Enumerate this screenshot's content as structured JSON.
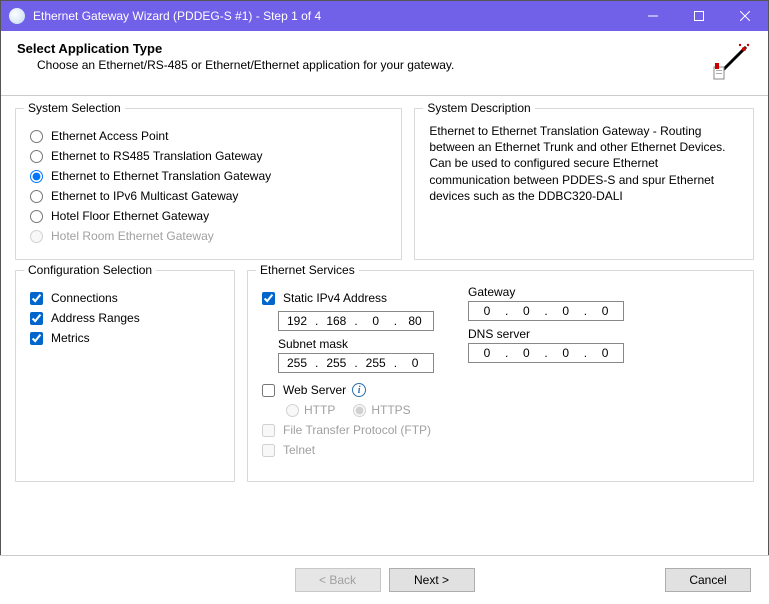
{
  "window": {
    "title": "Ethernet Gateway Wizard (PDDEG-S #1) - Step 1 of 4"
  },
  "header": {
    "title": "Select Application Type",
    "subtitle": "Choose an Ethernet/RS-485 or Ethernet/Ethernet application for your gateway."
  },
  "systemSelection": {
    "legend": "System Selection",
    "options": [
      {
        "label": "Ethernet Access Point",
        "checked": false,
        "enabled": true
      },
      {
        "label": "Ethernet to RS485 Translation Gateway",
        "checked": false,
        "enabled": true
      },
      {
        "label": "Ethernet to Ethernet Translation Gateway",
        "checked": true,
        "enabled": true
      },
      {
        "label": "Ethernet to IPv6 Multicast Gateway",
        "checked": false,
        "enabled": true
      },
      {
        "label": "Hotel Floor Ethernet Gateway",
        "checked": false,
        "enabled": true
      },
      {
        "label": "Hotel Room Ethernet Gateway",
        "checked": false,
        "enabled": false
      }
    ]
  },
  "systemDescription": {
    "legend": "System Description",
    "text": "Ethernet to Ethernet Translation Gateway - Routing between an Ethernet Trunk and other Ethernet Devices. Can be used to configured secure Ethernet communication between PDDES-S and spur Ethernet devices such as the DDBC320-DALI"
  },
  "configSelection": {
    "legend": "Configuration Selection",
    "options": [
      {
        "label": "Connections",
        "checked": true
      },
      {
        "label": "Address Ranges",
        "checked": true
      },
      {
        "label": "Metrics",
        "checked": true
      }
    ]
  },
  "ethernetServices": {
    "legend": "Ethernet Services",
    "staticIpLabel": "Static IPv4 Address",
    "staticIpChecked": true,
    "staticIp": [
      "192",
      "168",
      "0",
      "80"
    ],
    "subnetLabel": "Subnet mask",
    "subnet": [
      "255",
      "255",
      "255",
      "0"
    ],
    "gatewayLabel": "Gateway",
    "gateway": [
      "0",
      "0",
      "0",
      "0"
    ],
    "dnsLabel": "DNS server",
    "dns": [
      "0",
      "0",
      "0",
      "0"
    ],
    "webServerLabel": "Web Server",
    "webServerChecked": false,
    "httpLabel": "HTTP",
    "httpsLabel": "HTTPS",
    "httpsSelected": true,
    "ftpLabel": "File Transfer Protocol (FTP)",
    "ftpChecked": false,
    "telnetLabel": "Telnet",
    "telnetChecked": false
  },
  "footer": {
    "back": "<  Back",
    "next": "Next  >",
    "cancel": "Cancel"
  }
}
